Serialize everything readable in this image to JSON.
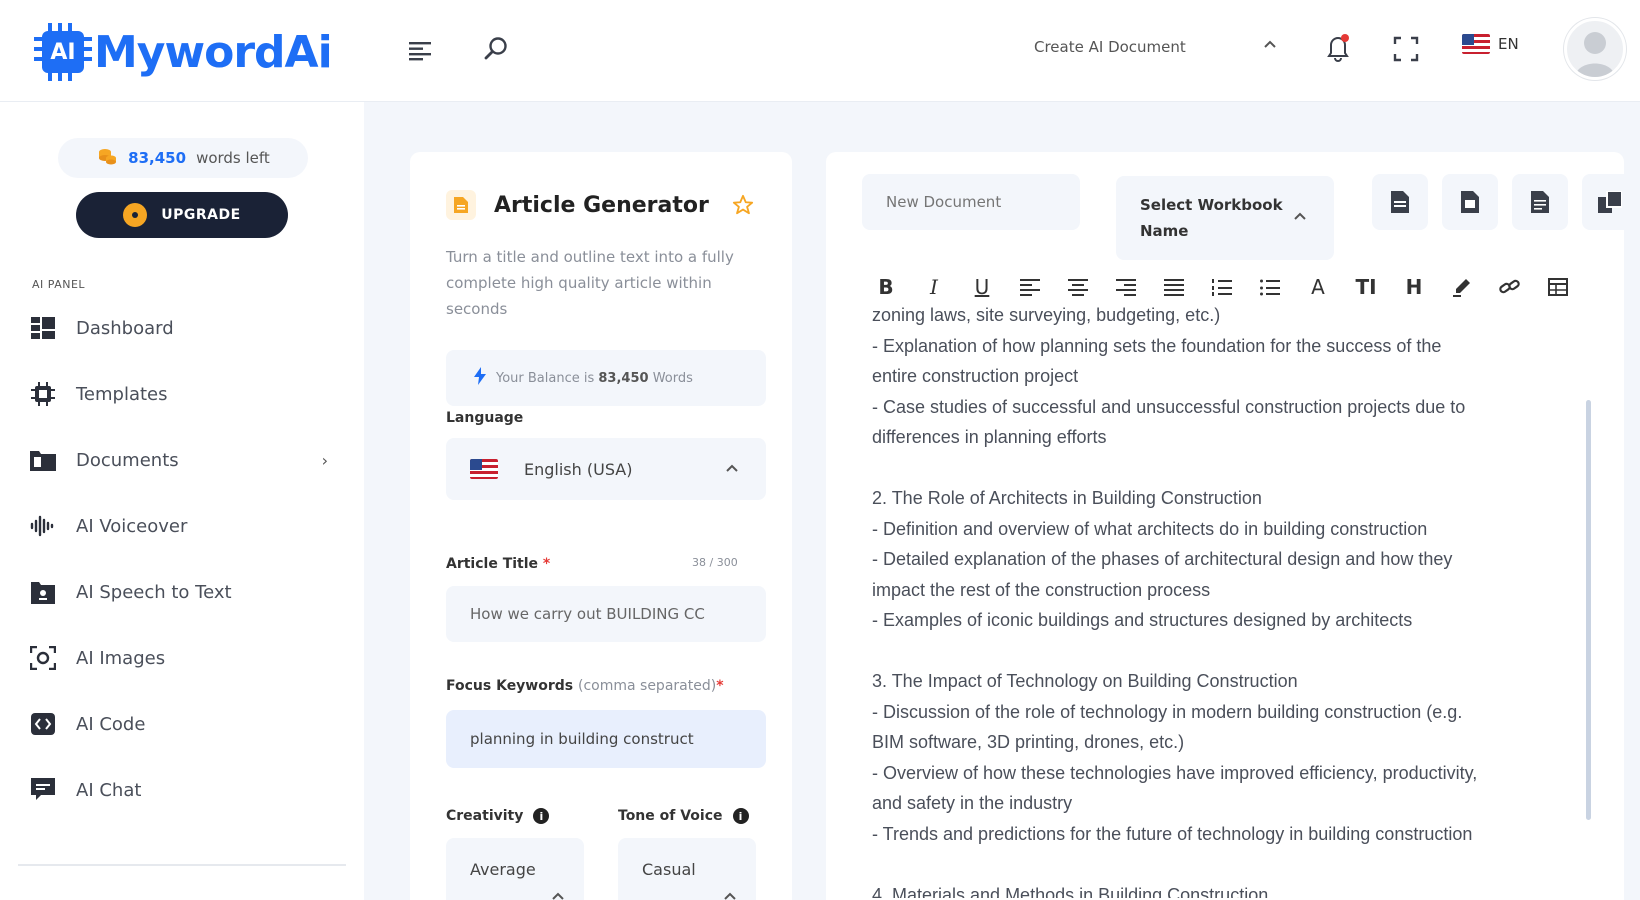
{
  "brand": {
    "name": "MywordAi",
    "chip_text": "AI",
    "color": "#1e6ef5"
  },
  "topbar": {
    "create_label": "Create AI Document",
    "lang_code": "EN"
  },
  "sidebar": {
    "words_count": "83,450",
    "words_label": "words left",
    "upgrade_label": "UPGRADE",
    "panel_title": "AI PANEL",
    "items": [
      {
        "label": "Dashboard",
        "icon": "dashboard-icon"
      },
      {
        "label": "Templates",
        "icon": "chip-icon"
      },
      {
        "label": "Documents",
        "icon": "folder-icon",
        "has_arrow": true
      },
      {
        "label": "AI Voiceover",
        "icon": "waveform-icon"
      },
      {
        "label": "AI Speech to Text",
        "icon": "speech-file-icon"
      },
      {
        "label": "AI Images",
        "icon": "camera-icon"
      },
      {
        "label": "AI Code",
        "icon": "code-icon"
      },
      {
        "label": "AI Chat",
        "icon": "chat-icon"
      }
    ]
  },
  "generator": {
    "title": "Article Generator",
    "description": "Turn a title and outline text into a fully complete high quality article within seconds",
    "balance_prefix": "Your Balance is",
    "balance_value": "83,450",
    "balance_suffix": "Words",
    "language_label": "Language",
    "language_value": "English (USA)",
    "title_label": "Article Title",
    "title_counter": "38 / 300",
    "title_value": "How we carry out BUILDING CC",
    "keywords_label": "Focus Keywords",
    "keywords_hint": "(comma separated)",
    "keywords_value": "planning in building construct",
    "creativity_label": "Creativity",
    "creativity_value": "Average",
    "tone_label": "Tone of Voice",
    "tone_value": "Casual"
  },
  "editor": {
    "doc_placeholder": "New Document",
    "workbook_line1": "Select Workbook",
    "workbook_line2": "Name",
    "lines": [
      "zoning laws, site surveying, budgeting, etc.)",
      "- Explanation of how planning sets the foundation for the success of the",
      "entire construction project",
      "- Case studies of successful and unsuccessful construction projects due to",
      "differences in planning efforts",
      "",
      "2. The Role of Architects in Building Construction",
      "- Definition and overview of what architects do in building construction",
      "- Detailed explanation of the phases of architectural design and how they",
      "impact the rest of the construction process",
      "- Examples of iconic buildings and structures designed by architects",
      "",
      "3. The Impact of Technology on Building Construction",
      "- Discussion of the role of technology in modern building construction (e.g.",
      "BIM software, 3D printing, drones, etc.)",
      "- Overview of how these technologies have improved efficiency, productivity,",
      "and safety in the industry",
      "- Trends and predictions for the future of technology in building construction",
      "",
      "4. Materials and Methods in Building Construction"
    ]
  }
}
